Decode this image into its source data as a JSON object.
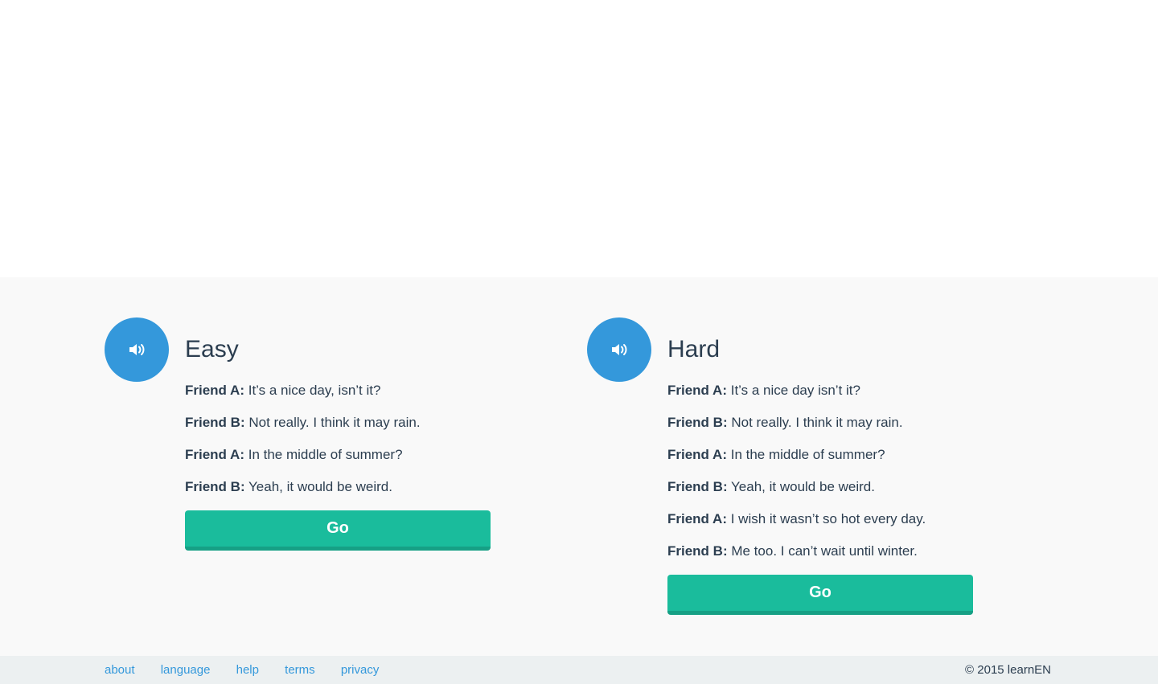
{
  "lessons": {
    "easy": {
      "title": "Easy",
      "lines": [
        {
          "speaker": "Friend A:",
          "text": "It’s a nice day, isn’t it?"
        },
        {
          "speaker": "Friend B:",
          "text": "Not really. I think it may rain."
        },
        {
          "speaker": "Friend A:",
          "text": "In the middle of summer?"
        },
        {
          "speaker": "Friend B:",
          "text": "Yeah, it would be weird."
        }
      ],
      "go_label": "Go"
    },
    "hard": {
      "title": "Hard",
      "lines": [
        {
          "speaker": "Friend A:",
          "text": "It’s a nice day isn’t it?"
        },
        {
          "speaker": "Friend B:",
          "text": "Not really. I think it may rain."
        },
        {
          "speaker": "Friend A:",
          "text": "In the middle of summer?"
        },
        {
          "speaker": "Friend B:",
          "text": "Yeah, it would be weird."
        },
        {
          "speaker": "Friend A:",
          "text": "I wish it wasn’t so hot every day."
        },
        {
          "speaker": "Friend B:",
          "text": "Me too. I can’t wait until winter."
        }
      ],
      "go_label": "Go"
    }
  },
  "icons": {
    "audio": "speaker-volume-icon"
  },
  "footer": {
    "links": [
      "about",
      "language",
      "help",
      "terms",
      "privacy"
    ],
    "copyright": "© 2015 learnEN"
  },
  "colors": {
    "primary_blue": "#3498db",
    "go_green": "#1abc9c",
    "go_green_dark": "#16a085",
    "text_dark": "#2c3e50",
    "footer_bg": "#ecf0f1"
  }
}
